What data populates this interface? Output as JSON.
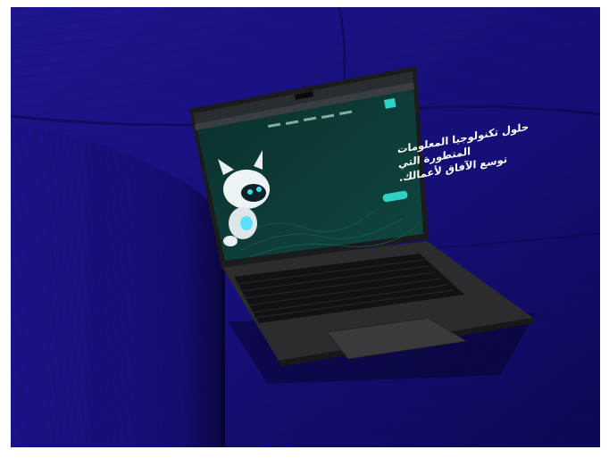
{
  "scene": {
    "colors": {
      "background": "#ffffff",
      "couch": "#1a1280",
      "couch_dark": "#0c0850",
      "laptop_body": "#2a2a2c",
      "keyboard": "#121214",
      "screen_bg": "#0f3a36",
      "accent": "#2fd1c4"
    }
  },
  "website": {
    "hero_line_1": "حلول تكنولوجيا المعلومات",
    "hero_line_2": "المتطورة التي",
    "hero_line_3": "توسع الآفاق لأعمالك."
  }
}
